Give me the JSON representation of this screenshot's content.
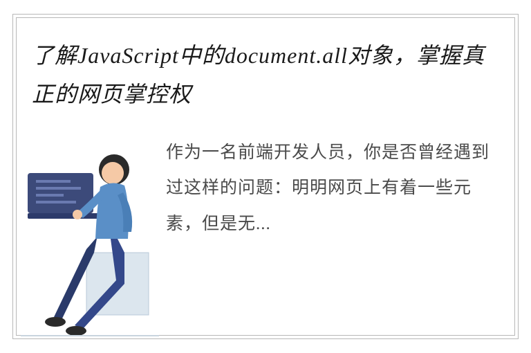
{
  "title": "了解JavaScript中的document.all对象，掌握真正的网页掌控权",
  "body": "作为一名前端开发人员，你是否曾经遇到过这样的问题：明明网页上有着一些元素，但是无...",
  "illustration": {
    "name": "person-sitting-laptop-illustration"
  }
}
